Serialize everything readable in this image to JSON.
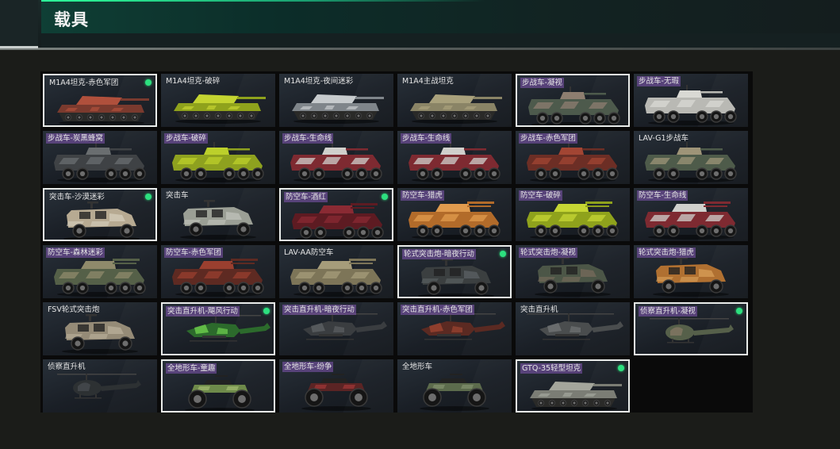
{
  "header": {
    "title": "载具"
  },
  "vehicles": [
    {
      "name": "M1A4坦克-赤色军团",
      "kind": "tank",
      "colors": [
        "#7a3a2e",
        "#b0503c"
      ],
      "selected": true,
      "equipped": true,
      "tag": false
    },
    {
      "name": "M1A4坦克-破碎",
      "kind": "tank",
      "colors": [
        "#8fa21c",
        "#c4d431"
      ],
      "selected": false,
      "equipped": false,
      "tag": false
    },
    {
      "name": "M1A4坦克-夜间迷彩",
      "kind": "tank",
      "colors": [
        "#7f858a",
        "#c7cbcd"
      ],
      "selected": false,
      "equipped": false,
      "tag": false
    },
    {
      "name": "M1A4主战坦克",
      "kind": "tank",
      "colors": [
        "#8a8466",
        "#a9a17c"
      ],
      "selected": false,
      "equipped": false,
      "tag": false
    },
    {
      "name": "步战车-凝视",
      "kind": "ifv",
      "colors": [
        "#4d5a4c",
        "#8e7e70"
      ],
      "selected": true,
      "equipped": false,
      "tag": true
    },
    {
      "name": "步战车-无瑕",
      "kind": "ifv",
      "colors": [
        "#b9b9b4",
        "#d9d9d4"
      ],
      "selected": false,
      "equipped": false,
      "tag": true
    },
    {
      "name": "步战车-炭黑蜂窝",
      "kind": "ifv",
      "colors": [
        "#3f4245",
        "#6a6e70"
      ],
      "selected": false,
      "equipped": false,
      "tag": true
    },
    {
      "name": "步战车-破碎",
      "kind": "ifv",
      "colors": [
        "#8ea11f",
        "#bcd02b"
      ],
      "selected": false,
      "equipped": false,
      "tag": true
    },
    {
      "name": "步战车-生命线",
      "kind": "ifv",
      "colors": [
        "#7e2a31",
        "#d0d0cc"
      ],
      "selected": false,
      "equipped": false,
      "tag": true
    },
    {
      "name": "步战车-生命线",
      "kind": "ifv",
      "colors": [
        "#7e2a31",
        "#d0d0cc"
      ],
      "selected": false,
      "equipped": false,
      "tag": true
    },
    {
      "name": "步战车-赤色军团",
      "kind": "ifv",
      "colors": [
        "#6c2e25",
        "#a24533"
      ],
      "selected": false,
      "equipped": false,
      "tag": true
    },
    {
      "name": "LAV-G1步战车",
      "kind": "ifv",
      "colors": [
        "#4e5b4a",
        "#9e9478"
      ],
      "selected": false,
      "equipped": false,
      "tag": false
    },
    {
      "name": "突击车-沙漠迷彩",
      "kind": "mrap",
      "colors": [
        "#b7aa92",
        "#d6cfbe"
      ],
      "selected": true,
      "equipped": true,
      "tag": false
    },
    {
      "name": "突击车",
      "kind": "mrap",
      "colors": [
        "#9b9f95",
        "#c2c4bd"
      ],
      "selected": false,
      "equipped": false,
      "tag": false
    },
    {
      "name": "防空车-酒红",
      "kind": "aa",
      "colors": [
        "#5d1b22",
        "#8a2a33"
      ],
      "selected": true,
      "equipped": true,
      "tag": true
    },
    {
      "name": "防空车-猎虎",
      "kind": "aa",
      "colors": [
        "#b26b2a",
        "#e09b4e"
      ],
      "selected": false,
      "equipped": false,
      "tag": true
    },
    {
      "name": "防空车-破碎",
      "kind": "aa",
      "colors": [
        "#8fa21c",
        "#c6d634"
      ],
      "selected": false,
      "equipped": false,
      "tag": true
    },
    {
      "name": "防空车-生命线",
      "kind": "aa",
      "colors": [
        "#7e2a31",
        "#d0d0cc"
      ],
      "selected": false,
      "equipped": false,
      "tag": true
    },
    {
      "name": "防空车-森林迷彩",
      "kind": "aa",
      "colors": [
        "#556048",
        "#8f8a6b"
      ],
      "selected": false,
      "equipped": false,
      "tag": true
    },
    {
      "name": "防空车-赤色军团",
      "kind": "aa",
      "colors": [
        "#5e2a22",
        "#9a3f2f"
      ],
      "selected": false,
      "equipped": false,
      "tag": true
    },
    {
      "name": "LAV-AA防空车",
      "kind": "aa",
      "colors": [
        "#7d7558",
        "#a69c7a"
      ],
      "selected": false,
      "equipped": false,
      "tag": false
    },
    {
      "name": "轮式突击炮-暗夜行动",
      "kind": "mrap",
      "colors": [
        "#3b3f40",
        "#5e6466"
      ],
      "selected": true,
      "equipped": true,
      "tag": true
    },
    {
      "name": "轮式突击炮-凝视",
      "kind": "mrap",
      "colors": [
        "#4c5647",
        "#7a6c5c"
      ],
      "selected": false,
      "equipped": false,
      "tag": true
    },
    {
      "name": "轮式突击炮-猎虎",
      "kind": "mrap",
      "colors": [
        "#b07031",
        "#dba25b"
      ],
      "selected": false,
      "equipped": false,
      "tag": true
    },
    {
      "name": "FSV轮式突击炮",
      "kind": "mrap",
      "colors": [
        "#958b77",
        "#bcb29c"
      ],
      "selected": false,
      "equipped": false,
      "tag": false
    },
    {
      "name": "突击直升机-飓风行动",
      "kind": "heli",
      "colors": [
        "#2c6a2c",
        "#6fd04e"
      ],
      "selected": true,
      "equipped": true,
      "tag": true
    },
    {
      "name": "突击直升机-暗夜行动",
      "kind": "heli",
      "colors": [
        "#3a3d40",
        "#5c6063"
      ],
      "selected": false,
      "equipped": false,
      "tag": true
    },
    {
      "name": "突击直升机-赤色军团",
      "kind": "heli",
      "colors": [
        "#5b2a22",
        "#9c4431"
      ],
      "selected": false,
      "equipped": false,
      "tag": true
    },
    {
      "name": "突击直升机",
      "kind": "heli",
      "colors": [
        "#4a4d4e",
        "#707475"
      ],
      "selected": false,
      "equipped": false,
      "tag": false
    },
    {
      "name": "侦察直升机-凝视",
      "kind": "smallheli",
      "colors": [
        "#56604a",
        "#8a7b66"
      ],
      "selected": true,
      "equipped": true,
      "tag": true
    },
    {
      "name": "侦察直升机",
      "kind": "smallheli",
      "colors": [
        "#2d3133",
        "#4a4f52"
      ],
      "selected": false,
      "equipped": false,
      "tag": false
    },
    {
      "name": "全地形车-童趣",
      "kind": "atv",
      "colors": [
        "#6e8a4a",
        "#9cb56c"
      ],
      "selected": true,
      "equipped": false,
      "tag": true
    },
    {
      "name": "全地形车-纷争",
      "kind": "atv",
      "colors": [
        "#5b2424",
        "#9a3535"
      ],
      "selected": false,
      "equipped": false,
      "tag": true
    },
    {
      "name": "全地形车",
      "kind": "atv",
      "colors": [
        "#5c6b4c",
        "#7e8d6a"
      ],
      "selected": false,
      "equipped": false,
      "tag": false
    },
    {
      "name": "GTQ-35轻型坦克",
      "kind": "tank",
      "colors": [
        "#7b7d75",
        "#a4a69c"
      ],
      "selected": true,
      "equipped": true,
      "tag": true
    }
  ]
}
